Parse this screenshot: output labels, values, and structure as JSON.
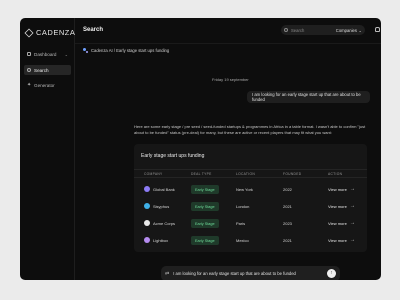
{
  "brand": {
    "name": "CADENZA"
  },
  "sidebar": {
    "items": [
      {
        "label": "Dashboard",
        "icon": "grid-icon",
        "chevron": "⌄"
      },
      {
        "label": "Search",
        "icon": "search-icon"
      },
      {
        "label": "Generator",
        "icon": "sparkle-icon"
      }
    ]
  },
  "header": {
    "title": "Search",
    "search_placeholder": "Search",
    "filter_label": "Companies",
    "filter_chevron": "⌄"
  },
  "breadcrumb": {
    "text": "Cadenza AI / Early stage start ups funding"
  },
  "chat": {
    "date": "Friday 19 september",
    "user_message": "I am looking for an early stage start up that are about to be funded",
    "ai_message": "Here are some early stage / pre seed / seed-funded startups & programmes in Africa in a table format. I wasn't able to confirm \"just about to be funded\" status (pre-deal) for many, but these are active or recent players that may fit what you want:"
  },
  "table": {
    "title": "Early stage start ups funding",
    "headers": [
      "COMPANY",
      "DEAL TYPE",
      "LOCATION",
      "FOUNDED",
      "ACTION"
    ],
    "rows": [
      {
        "company": "Global Bank",
        "deal": "Early Stage",
        "location": "New York",
        "founded": "2022",
        "action": "View more",
        "icon_color": "#8d7cf6"
      },
      {
        "company": "Sisyphus",
        "deal": "Early Stage",
        "location": "London",
        "founded": "2021",
        "action": "View more",
        "icon_color": "#3fb0e8"
      },
      {
        "company": "Acme Corps",
        "deal": "Early Stage",
        "location": "Paris",
        "founded": "2023",
        "action": "View more",
        "icon_color": "#e8e8e8"
      },
      {
        "company": "Lightbox",
        "deal": "Early Stage",
        "location": "Mexico",
        "founded": "2021",
        "action": "View more",
        "icon_color": "#b58cf0"
      }
    ]
  },
  "composer": {
    "text": "I am looking for an early stage start up that are about to be funded",
    "send_glyph": "↑",
    "swap_glyph": "⇄"
  },
  "colors": {
    "background": "#ebebeb",
    "app": "#0d0d0d",
    "card": "#161616",
    "badge_bg": "#1f3a2a",
    "badge_text": "#6fdc9a"
  }
}
